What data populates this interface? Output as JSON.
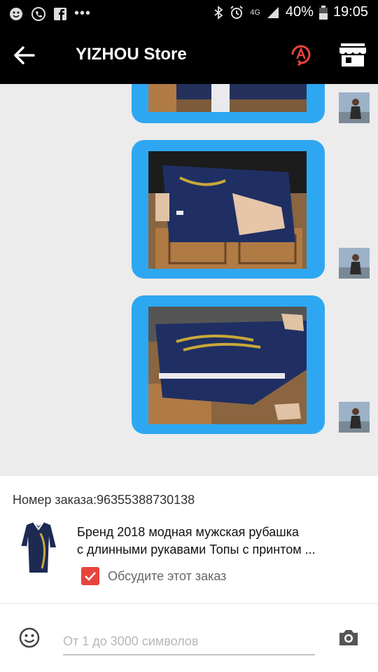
{
  "status_bar": {
    "battery": "40%",
    "time": "19:05",
    "network": "4G"
  },
  "header": {
    "title": "YIZHOU Store",
    "back_icon": "arrow-left-icon",
    "alert_icon": "alert-badge-icon",
    "store_icon": "store-icon"
  },
  "chat": {
    "messages": [
      {
        "type": "image"
      },
      {
        "type": "image"
      },
      {
        "type": "image"
      }
    ]
  },
  "order": {
    "number_label": "Номер заказа:96355388730138",
    "product_title_line1": "Бренд 2018 модная мужская рубашка",
    "product_title_line2": "с длинными рукавами Топы с принтом ...",
    "discuss_label": "Обсудите этот заказ",
    "discuss_checked": true
  },
  "input": {
    "placeholder": "От 1 до 3000 символов",
    "value": ""
  },
  "colors": {
    "accent": "#2ea7f2",
    "alert": "#e8443d",
    "header": "#000000"
  }
}
